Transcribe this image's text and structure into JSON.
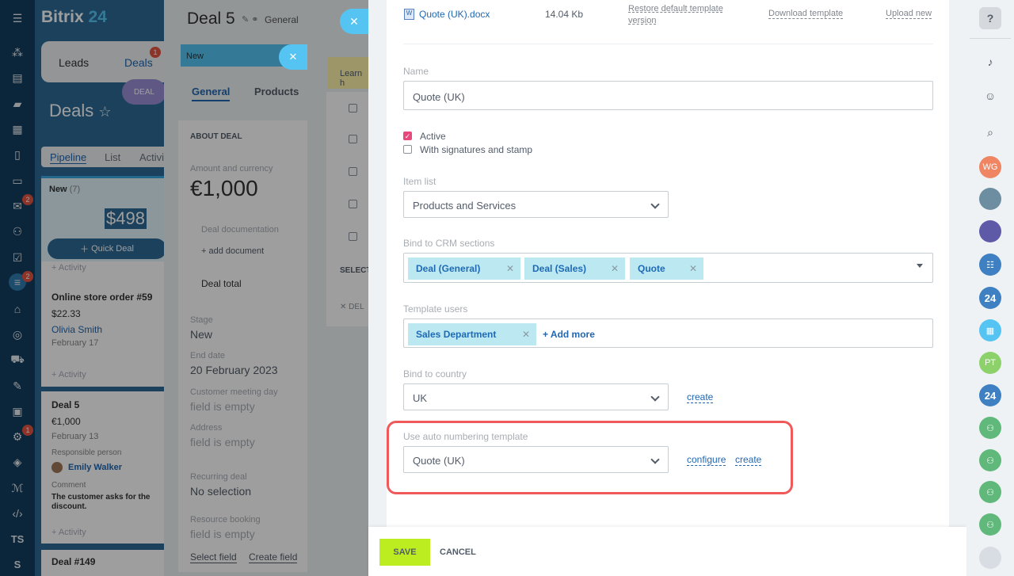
{
  "left_nav": {
    "badges": [
      "2",
      "2",
      "1"
    ],
    "initials": [
      "TS",
      "S"
    ]
  },
  "crm": {
    "logo_a": "Bitrix",
    "logo_b": "24",
    "tab_leads": "Leads",
    "tab_deals": "Deals",
    "deals_badge": "1",
    "title": "Deals",
    "deal_pill": "DEAL",
    "views": [
      "Pipeline",
      "List",
      "Activi"
    ],
    "column_title": "New",
    "column_count": "(7)",
    "column_sum": "$498",
    "quick_deal": "Quick Deal",
    "activity": "+ Activity",
    "feb": "Feb",
    "cards": [
      {
        "title": "Online store order #59",
        "amount": "$22.33",
        "person": "Olivia Smith",
        "date": "February 17"
      },
      {
        "title": "Deal 5",
        "amount": "€1,000",
        "date": "February 13",
        "resp_label": "Responsible person",
        "resp": "Emily Walker",
        "comment_label": "Comment",
        "comment": "The customer asks for the discount."
      },
      {
        "title": "Deal #149"
      }
    ]
  },
  "deal": {
    "title": "Deal 5",
    "category": "General",
    "stage_pill": "New",
    "tab_general": "General",
    "tab_products": "Products",
    "section": "ABOUT DEAL",
    "amount_label": "Amount and currency",
    "amount": "€1,000",
    "doc_label": "Deal documentation",
    "add_doc": "+ add document",
    "total_label": "Deal total",
    "stage_label": "Stage",
    "stage": "New",
    "end_label": "End date",
    "end": "20 February 2023",
    "meeting_label": "Customer meeting day",
    "empty": "field is empty",
    "address_label": "Address",
    "recurring_label": "Recurring deal",
    "recurring": "No selection",
    "resource_label": "Resource booking",
    "select_field": "Select field",
    "create_field": "Create field",
    "learn": "Learn h",
    "select": "SELECT",
    "del": "DEL"
  },
  "form": {
    "file_name": "Quote (UK).docx",
    "file_size": "14.04 Kb",
    "restore": "Restore default template version",
    "download": "Download template",
    "upload": "Upload new",
    "name_label": "Name",
    "name_value": "Quote (UK)",
    "active": "Active",
    "signatures": "With signatures and stamp",
    "item_list_label": "Item list",
    "item_list": "Products and Services",
    "bind_crm_label": "Bind to CRM sections",
    "crm_chips": [
      "Deal (General)",
      "Deal (Sales)",
      "Quote"
    ],
    "users_label": "Template users",
    "user_chip": "Sales Department",
    "add_more": "+ Add more",
    "country_label": "Bind to country",
    "country": "UK",
    "create": "create",
    "numbering_label": "Use auto numbering template",
    "numbering": "Quote (UK)",
    "configure": "configure"
  },
  "footer": {
    "save": "SAVE",
    "cancel": "CANCEL"
  },
  "right": {
    "wg": "WG",
    "pt": "PT",
    "n24": "24"
  },
  "colors": {
    "accent": "#bbed21",
    "highlight": "#f0595a",
    "link": "#2067b0"
  }
}
